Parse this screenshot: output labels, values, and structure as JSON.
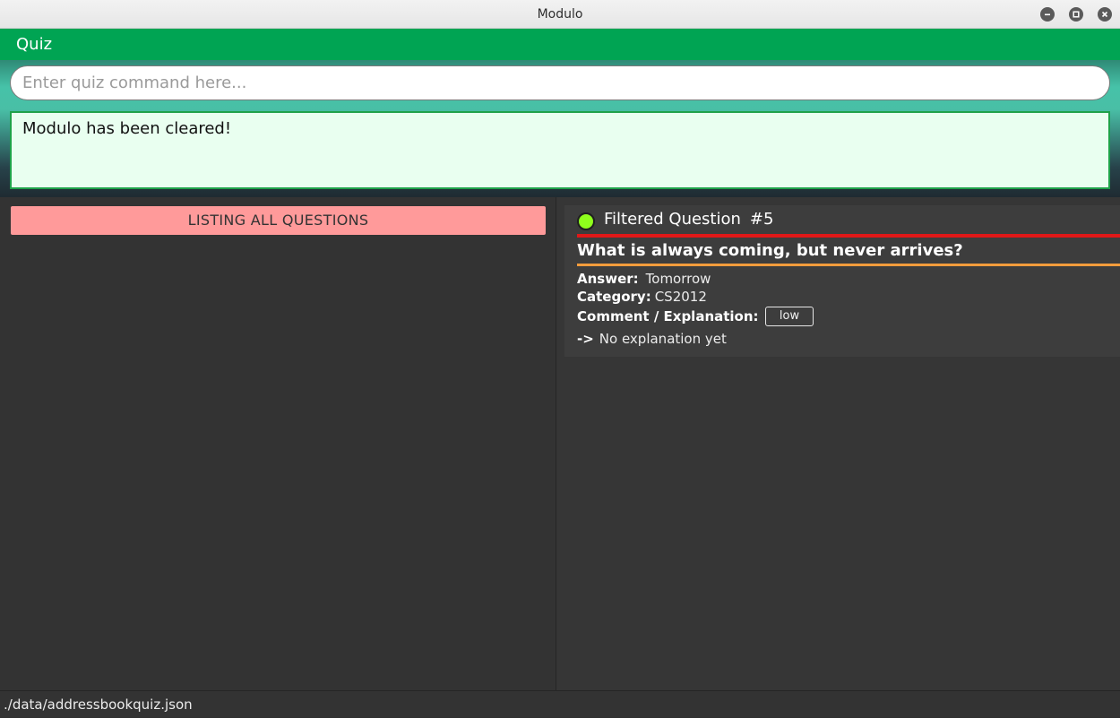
{
  "window": {
    "title": "Modulo"
  },
  "menu": {
    "items": [
      {
        "label": "Quiz"
      }
    ]
  },
  "command": {
    "placeholder": "Enter quiz command here...",
    "value": ""
  },
  "result": {
    "message": "Modulo has been cleared!"
  },
  "list_panel": {
    "banner": "LISTING ALL QUESTIONS",
    "banner_color": "#ff9a9a"
  },
  "question_card": {
    "heading": "Filtered Question",
    "number": "#5",
    "status_color": "#8fff1c",
    "question": "What is always coming, but never arrives?",
    "answer_label": "Answer:",
    "answer": "Tomorrow",
    "category_label": "Category:",
    "category": "CS2012",
    "comment_label": "Comment / Explanation:",
    "difficulty_tag": "low",
    "explanation_arrow": "->",
    "explanation": "No explanation yet"
  },
  "status_bar": {
    "path": "./data/addressbookquiz.json"
  },
  "colors": {
    "menu_bar": "#00a453",
    "red_underline": "#e01818",
    "orange_underline": "#f39c3c",
    "result_border": "#1fa24a",
    "result_background": "#e9fff0"
  }
}
